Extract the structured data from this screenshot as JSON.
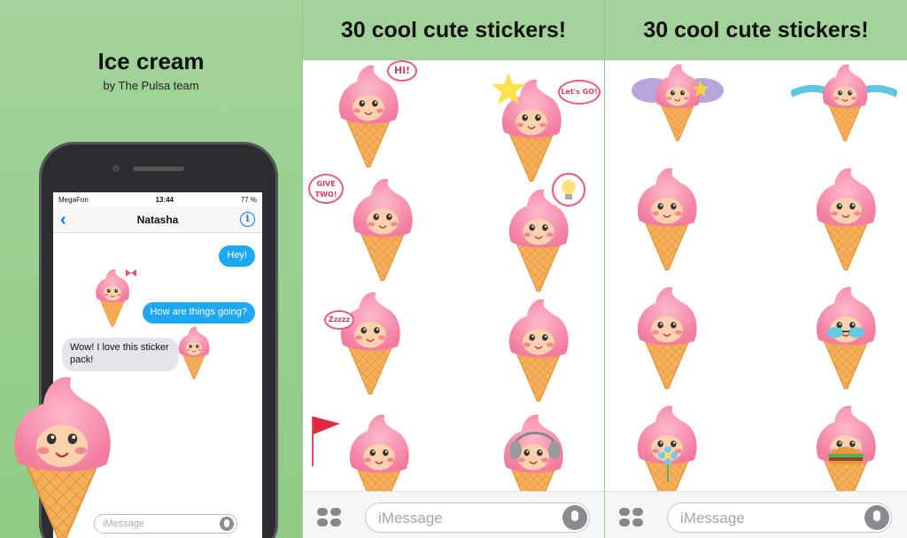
{
  "promo": {
    "title": "Ice cream",
    "subtitle": "by The Pulsa team"
  },
  "phone": {
    "carrier": "MegaFon",
    "time": "13:44",
    "battery": "77 %",
    "contact": "Natasha",
    "messages": [
      {
        "dir": "out",
        "text": "Hey!"
      },
      {
        "dir": "out",
        "text": "How are things going?"
      },
      {
        "dir": "in",
        "text": "Wow! I love this sticker pack!"
      }
    ],
    "input_placeholder": "iMessage"
  },
  "panels": [
    {
      "header": "30 cool cute stickers!",
      "input_placeholder": "iMessage"
    },
    {
      "header": "30 cool cute stickers!",
      "input_placeholder": "iMessage"
    }
  ],
  "speech": {
    "hi": "Hi!",
    "lets_go": "Let's GO!",
    "give_two": "GIVE TWO!",
    "zzz": "Zzzzz"
  },
  "colors": {
    "background": "#a3d39a",
    "bubble_out": "#1ea8f3",
    "bubble_in": "#e6e6ea",
    "accent": "#0b7cf8",
    "ice_cream_pink": "#f48fab",
    "cone": "#f5a64a"
  }
}
